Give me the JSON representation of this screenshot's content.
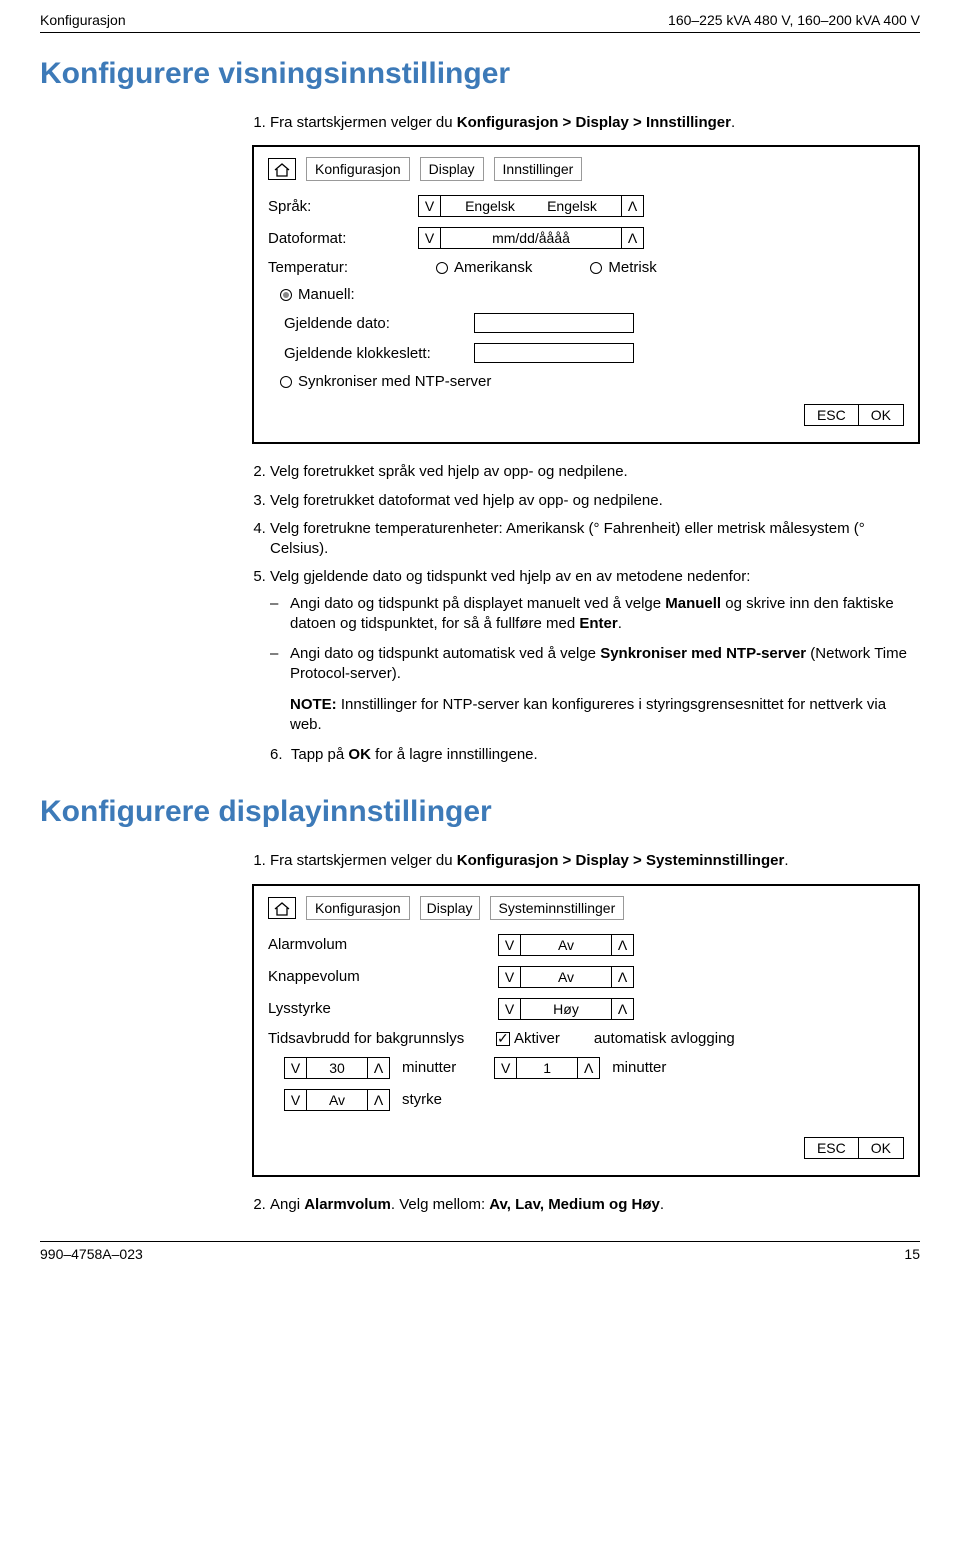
{
  "header": {
    "left": "Konfigurasjon",
    "right": "160–225 kVA 480 V, 160–200 kVA 400 V"
  },
  "h1": "Konfigurere visningsinnstillinger",
  "intro1_pre": "Fra startskjermen velger du ",
  "intro1_bold": "Konfigurasjon > Display > Innstillinger",
  "period": ".",
  "panel1": {
    "crumbs": [
      "Konfigurasjon",
      "Display",
      "Innstillinger"
    ],
    "lang_label": "Språk:",
    "lang_val_a": "Engelsk",
    "lang_val_b": "Engelsk",
    "date_label": "Datoformat:",
    "date_val": "mm/dd/åååå",
    "temp_label": "Temperatur:",
    "temp_opt1": "Amerikansk",
    "temp_opt2": "Metrisk",
    "manual_label": "Manuell:",
    "curdate_label": "Gjeldende dato:",
    "curtime_label": "Gjeldende klokkeslett:",
    "sync_label": "Synkroniser med NTP-server",
    "btn_esc": "ESC",
    "btn_ok": "OK"
  },
  "steps1": {
    "s2": "Velg foretrukket språk ved hjelp av opp- og nedpilene.",
    "s3": "Velg foretrukket datoformat ved hjelp av opp- og nedpilene.",
    "s4": "Velg foretrukne temperaturenheter: Amerikansk (° Fahrenheit) eller metrisk målesystem (° Celsius).",
    "s5": "Velg gjeldende dato og tidspunkt ved hjelp av en av metodene nedenfor:",
    "d1a": "Angi dato og tidspunkt på displayet manuelt ved å velge ",
    "d1b": "Manuell",
    "d1c": " og skrive inn den faktiske datoen og tidspunktet, for så å fullføre med ",
    "d1d": "Enter",
    "d2a": "Angi dato og tidspunkt automatisk ved å velge ",
    "d2b": "Synkroniser med NTP-server",
    "d2c": " (Network Time Protocol-server).",
    "note_label": "NOTE:",
    "note_body": " Innstillinger for NTP-server kan konfigureres i styringsgrensesnittet for nettverk via web.",
    "s6a": "Tapp på ",
    "s6b": "OK",
    "s6c": " for å lagre innstillingene."
  },
  "h2": "Konfigurere displayinnstillinger",
  "intro2_pre": "Fra startskjermen velger du ",
  "intro2_bold": "Konfigurasjon > Display > Systeminnstillinger",
  "panel2": {
    "crumbs": [
      "Konfigurasjon",
      "Display",
      "Systeminnstillinger"
    ],
    "alarm_label": "Alarmvolum",
    "alarm_val": "Av",
    "button_label": "Knappevolum",
    "button_val": "Av",
    "bright_label": "Lysstyrke",
    "bright_val": "Høy",
    "backlight_label": "Tidsavbrudd for bakgrunnslys",
    "enable_label": "Aktiver",
    "autolog_label": "automatisk avlogging",
    "timeout_val": "30",
    "minutes": "minutter",
    "autolog_val": "1",
    "strength_val": "Av",
    "strength_label": "styrke",
    "btn_esc": "ESC",
    "btn_ok": "OK"
  },
  "step2_2a": "Angi ",
  "step2_2b": "Alarmvolum",
  "step2_2c": ". Velg mellom: ",
  "step2_opts": "Av, Lav, Medium og Høy",
  "footer": {
    "left": "990–4758A–023",
    "right": "15"
  }
}
